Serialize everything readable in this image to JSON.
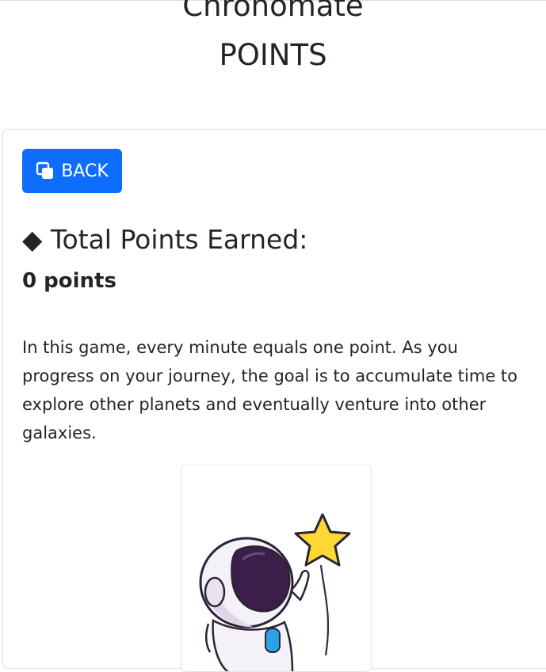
{
  "header": {
    "app_title": "Chronomate",
    "page_title": "POINTS"
  },
  "back_button": {
    "label": "BACK",
    "icon": "copy-icon",
    "color": "#0d6efd"
  },
  "points": {
    "heading_bullet": "◆",
    "heading": "Total Points Earned:",
    "value": "0 points"
  },
  "description": "In this game, every minute equals one point. As you progress on your journey, the goal is to accumulate time to explore other planets and eventually venture into other galaxies.",
  "illustration": {
    "subject": "astronaut-holding-star-balloon",
    "star_color": "#fdd835"
  }
}
